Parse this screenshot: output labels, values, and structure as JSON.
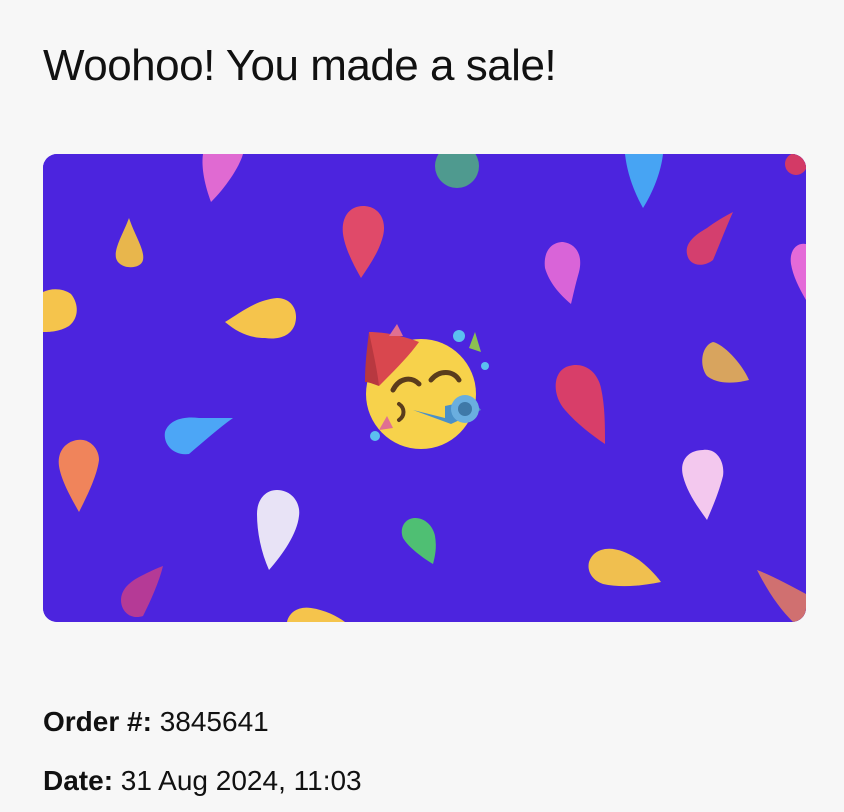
{
  "header": {
    "title": "Woohoo! You made a sale!"
  },
  "celebration": {
    "background_color": "#4c24de",
    "icon": "partying-face-icon",
    "confetti_icon": "confetti-drop-icon"
  },
  "order": {
    "label": "Order #:",
    "number": "3845641"
  },
  "date": {
    "label": "Date:",
    "value": "31 Aug 2024, 11:03"
  }
}
